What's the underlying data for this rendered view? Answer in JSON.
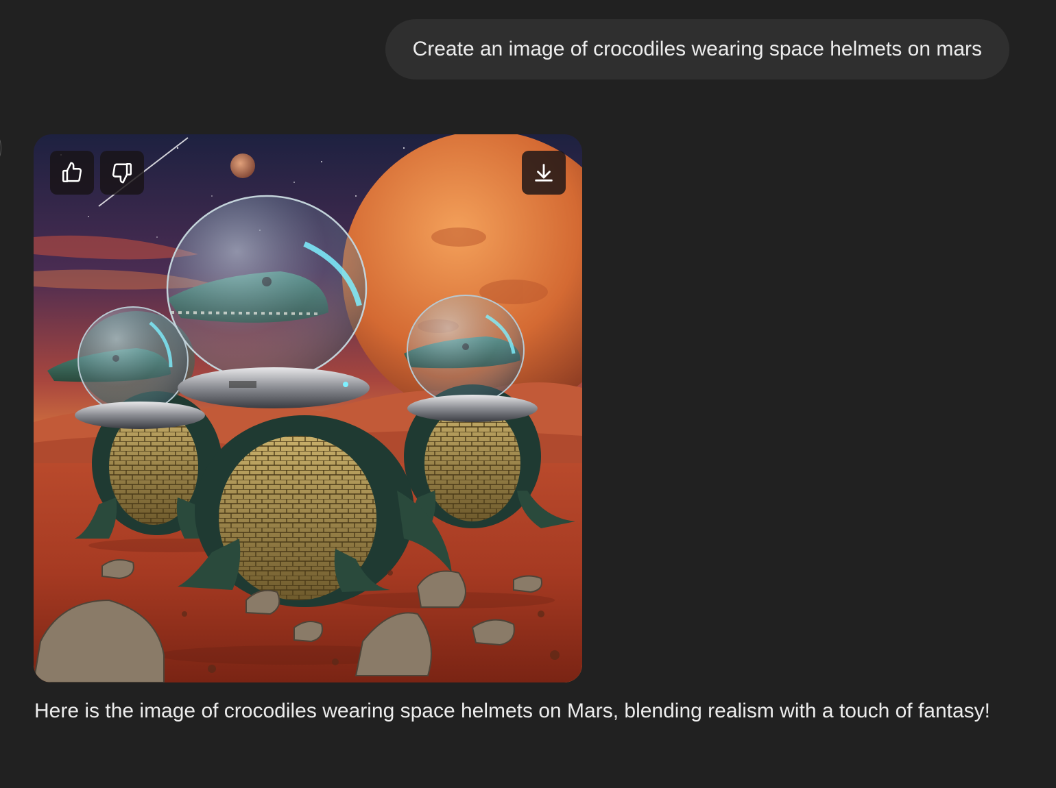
{
  "user_message": {
    "text": "Create an image of crocodiles wearing space helmets on mars"
  },
  "assistant_message": {
    "image": {
      "alt": "crocodiles wearing space helmets on mars",
      "actions": {
        "like_icon": "thumbs-up-icon",
        "dislike_icon": "thumbs-down-icon",
        "download_icon": "download-icon"
      }
    },
    "caption": "Here is the image of crocodiles wearing space helmets on Mars, blending realism with a touch of fantasy!"
  },
  "colors": {
    "background": "#212121",
    "user_bubble": "#2f2f2f",
    "text": "#ececec",
    "overlay_button": "#181416"
  }
}
